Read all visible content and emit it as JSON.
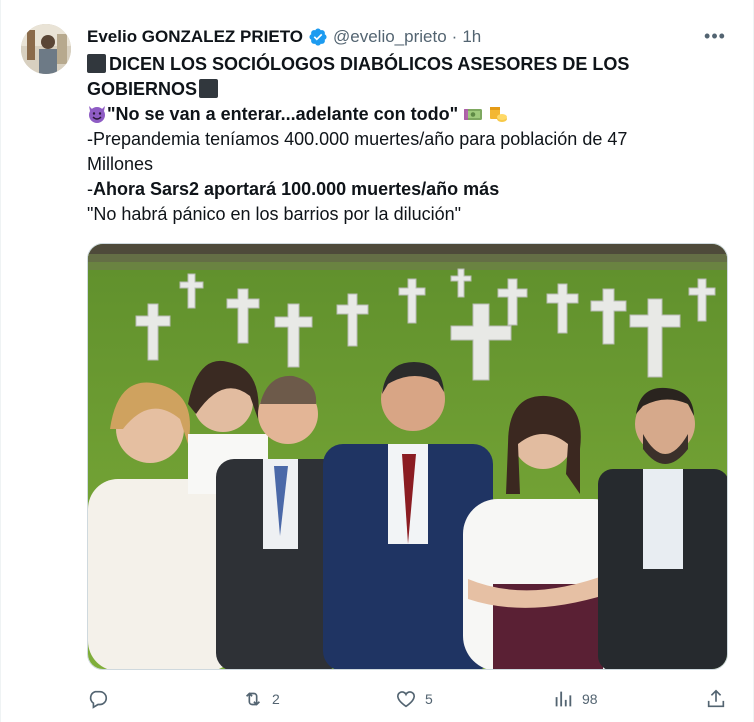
{
  "tweet": {
    "author_name": "Evelio GONZALEZ PRIETO",
    "handle": "@evelio_prieto",
    "separator": "·",
    "time": "1h",
    "more_label": "•••",
    "text": {
      "line1": "DICEN LOS SOCIÓLOGOS DIABÓLICOS ASESORES DE LOS",
      "line2": "GOBIERNOS",
      "line3": "\"No se van a enterar...adelante con todo\"",
      "line4": "-Prepandemia teníamos 400.000 muertes/año para población de 47",
      "line5": "Millones",
      "line6_prefix": "-",
      "line6_bold": "Ahora Sars2 aportará 100.000 muertes/año más",
      "line7": "\"No habrá pánico en los barrios por la dilución\""
    },
    "media": {
      "description_icon": "photo-collage-cemetery"
    },
    "actions": {
      "reply_count": "",
      "retweet_count": "2",
      "like_count": "5",
      "views_count": "98"
    }
  },
  "colors": {
    "text": "#0f1419",
    "muted": "#536471",
    "verified": "#1d9bf0",
    "black_square": "#31373d"
  }
}
